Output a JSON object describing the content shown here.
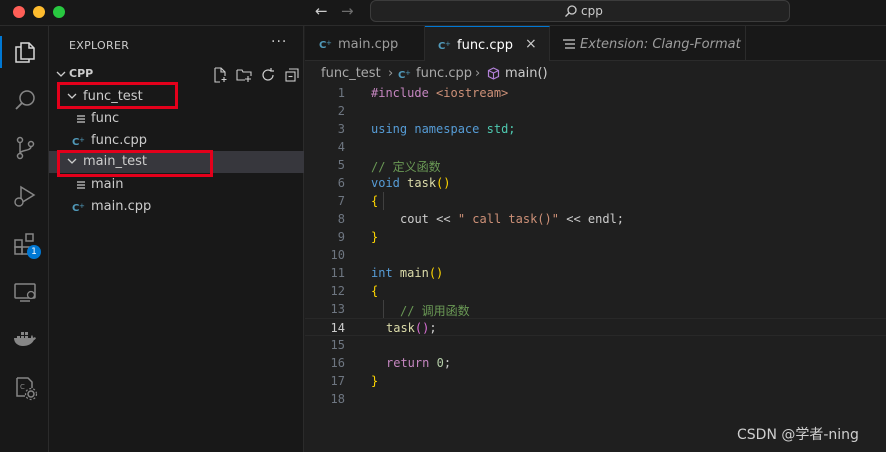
{
  "titlebar": {
    "search_text": "cpp"
  },
  "activitybar": {
    "extensions_badge": "1"
  },
  "explorer": {
    "title": "EXPLORER",
    "more": "···",
    "root_label": "CPP",
    "items": [
      {
        "label": "func_test",
        "type": "folder"
      },
      {
        "label": "func",
        "type": "file"
      },
      {
        "label": "func.cpp",
        "type": "cpp"
      },
      {
        "label": "main_test",
        "type": "folder"
      },
      {
        "label": "main",
        "type": "file"
      },
      {
        "label": "main.cpp",
        "type": "cpp"
      }
    ]
  },
  "tabs": [
    {
      "label": "main.cpp"
    },
    {
      "label": "func.cpp",
      "close": "×"
    },
    {
      "label": "Extension: Clang-Format"
    }
  ],
  "breadcrumb": {
    "folder": "func_test",
    "sep1": "›",
    "file": "func.cpp",
    "sep2": "›",
    "symbol": "main()"
  },
  "editor": {
    "line_numbers": [
      "1",
      "2",
      "3",
      "4",
      "5",
      "6",
      "7",
      "8",
      "9",
      "10",
      "11",
      "12",
      "13",
      "14",
      "15",
      "16",
      "17",
      "18"
    ],
    "current_line": "14",
    "tokens": {
      "l1_directive": "#include",
      "l1_header": "<iostream>",
      "l3_using": "using",
      "l3_namespace": "namespace",
      "l3_std": "std;",
      "l5_comment": "// 定义函数",
      "l6_type": "void",
      "l6_name": "task",
      "l6_parens": "()",
      "l7_brace": "{",
      "l8_cout": "cout",
      "l8_op1": "<<",
      "l8_string": "\" call task()\"",
      "l8_op2": "<<",
      "l8_endl": "endl;",
      "l9_brace": "}",
      "l11_type": "int",
      "l11_name": "main",
      "l11_parens": "()",
      "l12_brace": "{",
      "l13_comment": "// 调用函数",
      "l14_call": "task",
      "l14_parens": "()",
      "l14_semi": ";",
      "l16_return": "return",
      "l16_value": "0",
      "l16_semi": ";",
      "l17_brace": "}"
    }
  },
  "watermark": "CSDN @学者-ning",
  "colors": {
    "accent": "#0078d4",
    "highlight_box": "#e3001b",
    "keyword": "#569cd6",
    "function": "#dcdcaa",
    "string": "#ce9178",
    "comment": "#6a9955",
    "number": "#b5cea8",
    "brace": "#ffd700",
    "cpp_icon": "#519aba"
  }
}
